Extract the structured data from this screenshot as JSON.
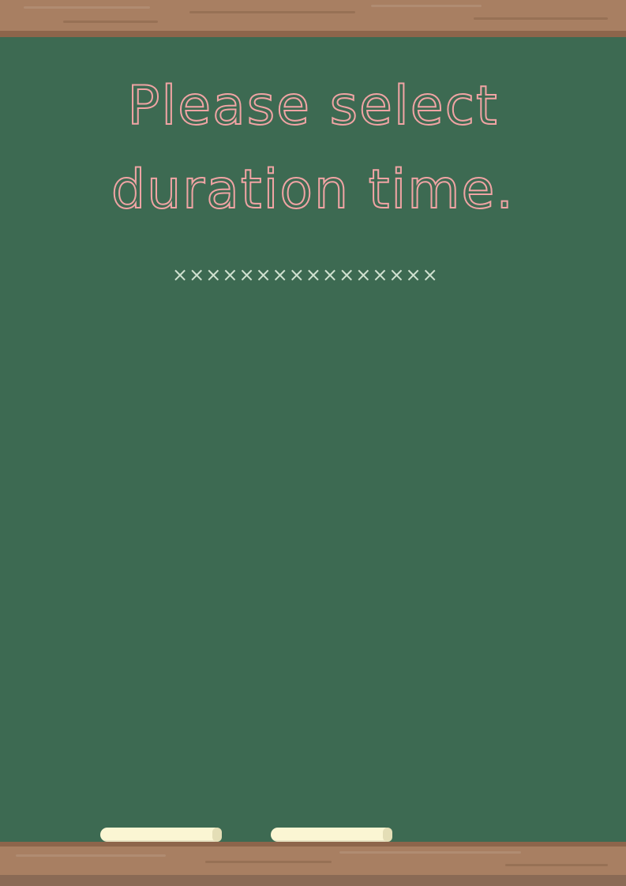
{
  "title": {
    "line1": "Please select",
    "line2": "duration time."
  },
  "divider": {
    "text": "××××××××××××××××"
  },
  "colors": {
    "board": "#3d6a52",
    "frame": "#a87f62",
    "frame_dark": "#8d654b",
    "title_chalk": "#f0a4a4",
    "divider": "#cfe0cf",
    "chalk": "#fbf6d3"
  }
}
